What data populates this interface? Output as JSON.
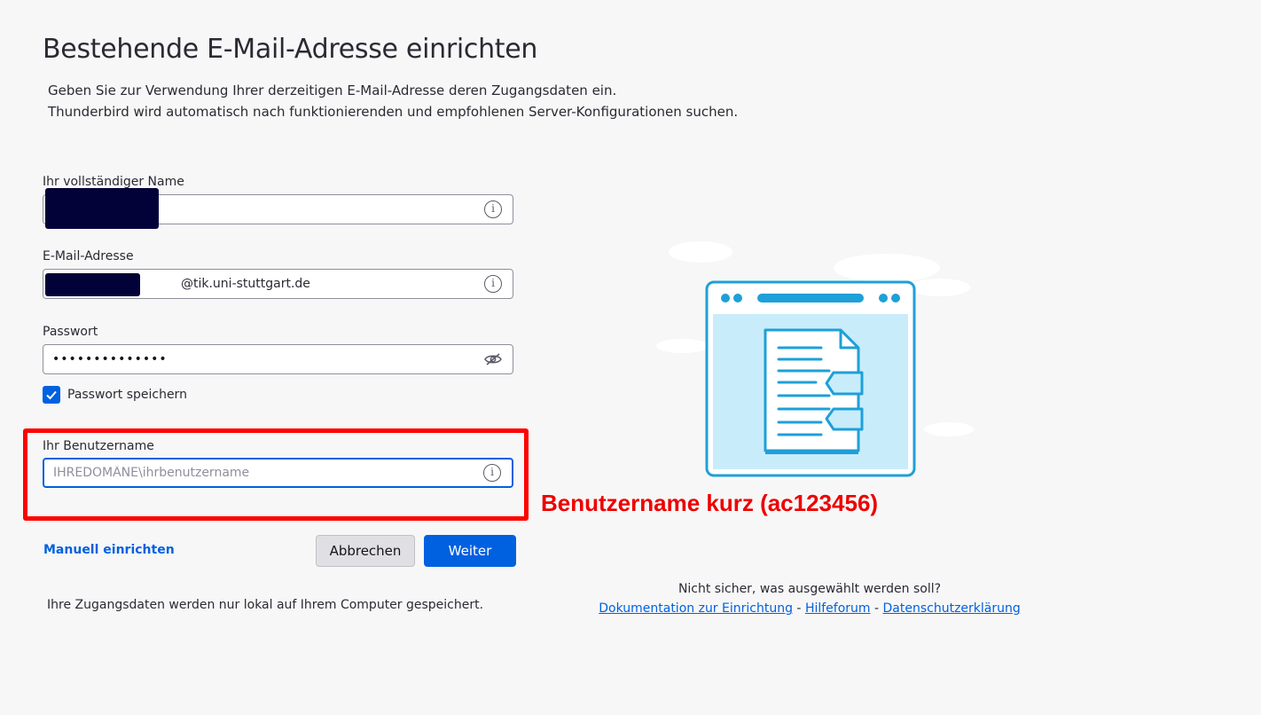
{
  "page": {
    "title": "Bestehende E-Mail-Adresse einrichten",
    "intro_line1": "Geben Sie zur Verwendung Ihrer derzeitigen E-Mail-Adresse deren Zugangsdaten ein.",
    "intro_line2": "Thunderbird wird automatisch nach funktionierenden und empfohlenen Server-Konfigurationen suchen."
  },
  "form": {
    "name_label": "Ihr vollständiger Name",
    "email_label": "E-Mail-Adresse",
    "email_domain": "@tik.uni-stuttgart.de",
    "password_label": "Passwort",
    "password_value": "••••••••••••••",
    "remember_label": "Passwort speichern",
    "remember_checked": true,
    "username_label": "Ihr Benutzername",
    "username_placeholder": "IHREDOMÄNE\\ihrbenutzername"
  },
  "annotation": "Benutzername kurz (ac123456)",
  "actions": {
    "manual_label": "Manuell einrichten",
    "cancel_label": "Abbrechen",
    "next_label": "Weiter"
  },
  "footer": {
    "local_note": "Ihre Zugangsdaten werden nur lokal auf Ihrem Computer gespeichert.",
    "help_question": "Nicht sicher, was ausgewählt werden soll?",
    "doc_link": "Dokumentation zur Einrichtung",
    "forum_link": "Hilfeforum",
    "privacy_link": "Datenschutzerklärung",
    "separator": "-"
  },
  "colors": {
    "accent": "#0061e0",
    "annotation_red": "#ff0000",
    "redaction": "#020238"
  }
}
